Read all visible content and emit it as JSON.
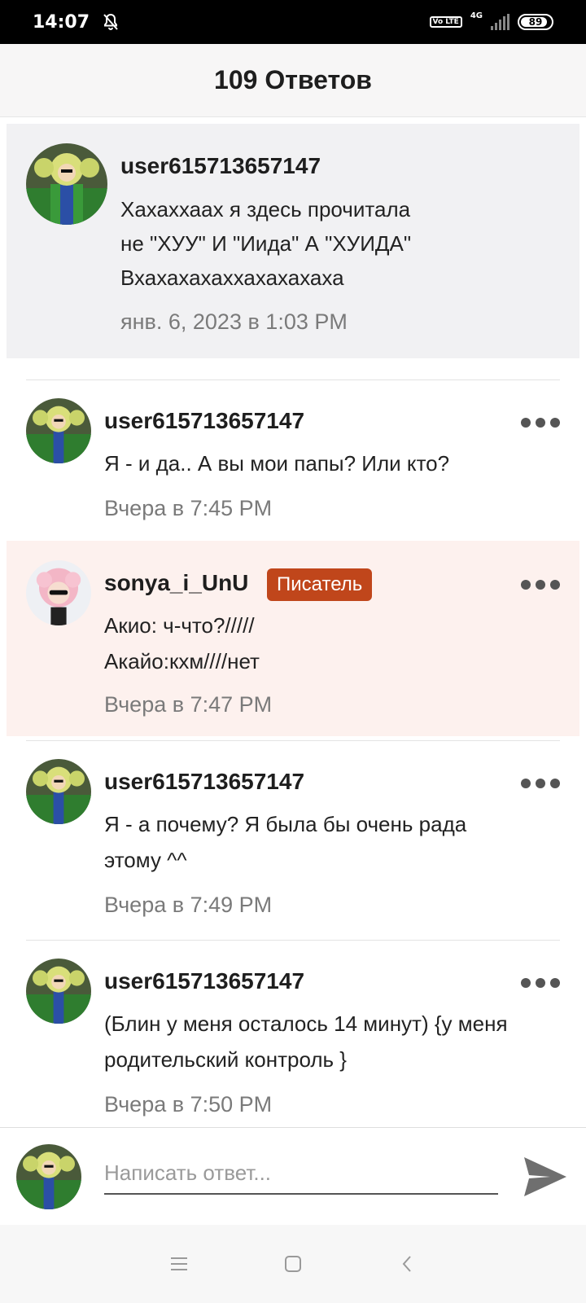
{
  "status_bar": {
    "time": "14:07",
    "volte": "Vo LTE",
    "network": "4G",
    "battery": "89",
    "battery_level": 0.89,
    "icons": [
      "bell-off-icon",
      "signal-icon",
      "battery-icon"
    ]
  },
  "header": {
    "title": "109 Ответов"
  },
  "original_comment": {
    "username": "user615713657147",
    "text_lines": [
      "Хахаххаах я здесь прочитала",
      "не \"ХУУ\" И \"Иида\" А \"ХУИДА\"",
      "Вхахахахаххахахахаха"
    ],
    "time": "янв. 6, 2023 в 1:03 PM"
  },
  "replies": [
    {
      "username": "user615713657147",
      "text_lines": [
        "Я - и да.. А вы мои папы? Или кто?"
      ],
      "time": "Вчера в 7:45 PM",
      "badge": ""
    },
    {
      "username": "sonya_i_UnU",
      "text_lines": [
        "Акио: ч-что?/////",
        "Акайо:кхм////нет"
      ],
      "time": "Вчера в 7:47 PM",
      "badge": "Писатель"
    },
    {
      "username": "user615713657147",
      "text_lines": [
        "Я - а почему? Я была бы очень рада",
        "этому ^^"
      ],
      "time": "Вчера в 7:49 PM",
      "badge": ""
    },
    {
      "username": "user615713657147",
      "text_lines": [
        "(Блин у меня осталось 14 минут) {у меня",
        "родительский контроль }"
      ],
      "time": "Вчера в 7:50 PM",
      "badge": ""
    }
  ],
  "input": {
    "placeholder": "Написать ответ..."
  },
  "colors": {
    "writer_badge": "#c0461b",
    "writer_background": "#fdf1ee",
    "original_background": "#f1f1f3"
  }
}
